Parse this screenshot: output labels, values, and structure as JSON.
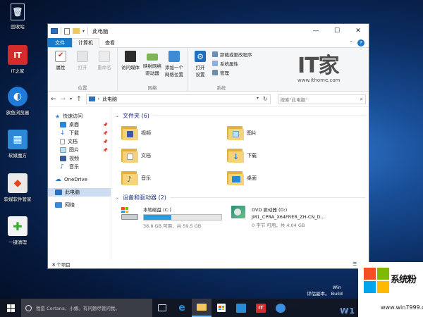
{
  "desktop": {
    "icons": [
      {
        "label": "回收站",
        "icon": "recycle-bin-icon",
        "color": "#9aa9bf",
        "glyph": "🗑"
      },
      {
        "label": "IT之家",
        "icon": "ithome-icon",
        "color": "#d62b2b",
        "glyph": "IT"
      },
      {
        "label": "旗鱼浏览器",
        "icon": "qiyu-browser-icon",
        "color": "#1f7bd8",
        "glyph": "◐"
      },
      {
        "label": "软媒魔方",
        "icon": "ruanmei-mofang-icon",
        "color": "#2c88d9",
        "glyph": "▦"
      },
      {
        "label": "软媒软件管家",
        "icon": "software-manager-icon",
        "color": "#e9e9e9",
        "glyph": "◆"
      },
      {
        "label": "一键清理",
        "icon": "one-click-clean-icon",
        "color": "#f2f2f2",
        "glyph": "✚"
      }
    ]
  },
  "window": {
    "title": "此电脑",
    "tabs": {
      "file": "文件",
      "computer": "计算机",
      "view": "查看"
    },
    "ribbon": {
      "location": {
        "name": "位置",
        "buttons": [
          {
            "label": "属性",
            "dim": false
          },
          {
            "label": "打开",
            "dim": true
          },
          {
            "label": "重命名",
            "dim": true
          }
        ]
      },
      "network": {
        "name": "网络",
        "buttons": [
          {
            "label": "访问媒体"
          },
          {
            "label": "映射网络驱动器"
          },
          {
            "label": "添加一个网络位置"
          }
        ]
      },
      "system": {
        "name": "系统",
        "open_settings": "打开设置",
        "items": [
          "卸载或更改程序",
          "系统属性",
          "管理"
        ]
      }
    },
    "nav_path": "此电脑",
    "search_placeholder": "搜索\"此电脑\"",
    "sidebar": {
      "quick_access": "快速访问",
      "items": [
        "桌面",
        "下载",
        "文档",
        "图片",
        "视频",
        "音乐"
      ],
      "onedrive": "OneDrive",
      "this_pc": "此电脑",
      "network": "网络"
    },
    "folders_header": "文件夹 (6)",
    "folders": [
      {
        "name": "视频",
        "badge": "#3a5a9c"
      },
      {
        "name": "图片",
        "badge": "#bde0f5"
      },
      {
        "name": "文档",
        "badge": "#ffffff"
      },
      {
        "name": "下载",
        "badge": "#2a7bd4"
      },
      {
        "name": "音乐",
        "badge": "#2c6fc2"
      },
      {
        "name": "桌面",
        "badge": "#2a87d8"
      }
    ],
    "drives_header": "设备和驱动器 (2)",
    "drives": [
      {
        "name": "本地磁盘 (C:)",
        "free": "38.8 GB 可用，共 59.5 GB",
        "used_fraction": 0.35
      },
      {
        "name": "DVD 驱动器 (D:)",
        "label": "JM1_CPRA_X64FRER_ZH-CN_D...",
        "free": "0 字节 可用，共 4.04 GB"
      }
    ],
    "status": "8 个项目"
  },
  "watermark": {
    "logo": "IT家",
    "url": "www.ithome.com"
  },
  "taskbar": {
    "cortana_text": "我是 Cortana，小娜。有问题尽管问我。",
    "apps": [
      {
        "icon": "task-view-icon",
        "color": "#cfd6e4",
        "active": false
      },
      {
        "icon": "edge-icon",
        "color": "#2a8ae0",
        "active": false
      },
      {
        "icon": "file-explorer-icon",
        "color": "#f4c65c",
        "active": true
      },
      {
        "icon": "store-icon",
        "color": "#2b7cd3",
        "active": false
      },
      {
        "icon": "ruanmei-icon",
        "color": "#2b8ad4",
        "active": false
      },
      {
        "icon": "ithome-taskbar-icon",
        "color": "#d62b2b",
        "active": false
      },
      {
        "icon": "qiyu-taskbar-icon",
        "color": "#3b8ee0",
        "active": false
      }
    ]
  },
  "eval_text": {
    "line1": "Win",
    "line2": "评估副本。 Build",
    "brand_row": "W1"
  },
  "brand": {
    "name": "系统粉",
    "site": "www.win7999.com"
  }
}
